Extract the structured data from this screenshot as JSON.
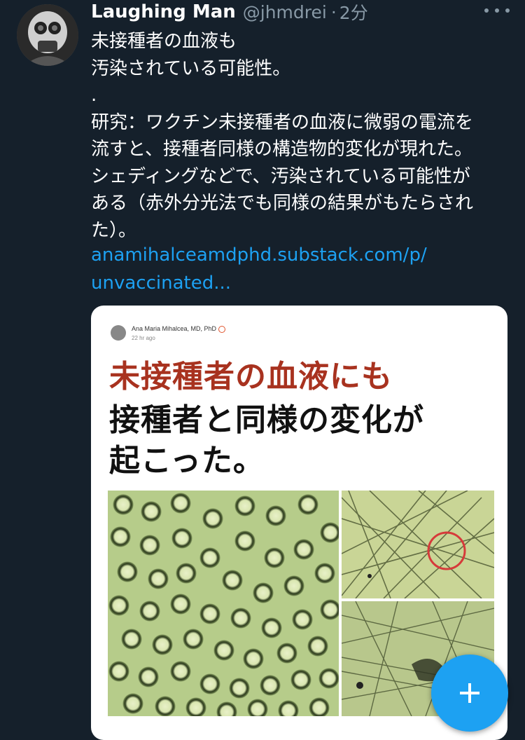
{
  "tweet": {
    "author_name": "Laughing Man",
    "handle": "@jhmdrei",
    "separator": "·",
    "time": "2分",
    "text": "未接種者の血液も\n汚染されている可能性。\n.\n研究：ワクチン未接種者の血液に微弱の電流を\n流すと、接種者同様の構造物的変化が現れた。\nシェディングなどで、汚染されている可能性が\nある（赤外分光法でも同様の結果がもたらされ\nた）。",
    "link_line1": "anamihalceamdphd.substack.com/p/",
    "link_line2": "unvaccinated..."
  },
  "card": {
    "author": "Ana Maria Mihalcea, MD, PhD",
    "posted": "22 hr ago",
    "headline_red": "未接種者の血液にも",
    "headline_line2": "接種者と同様の変化が",
    "headline_line3": "起こった。"
  },
  "icons": {
    "more": "more-options-icon",
    "compose": "compose-plus-icon"
  },
  "colors": {
    "background": "#15202b",
    "link": "#1da1f2",
    "muted": "#8899a6",
    "headline_red": "#a8321f"
  }
}
